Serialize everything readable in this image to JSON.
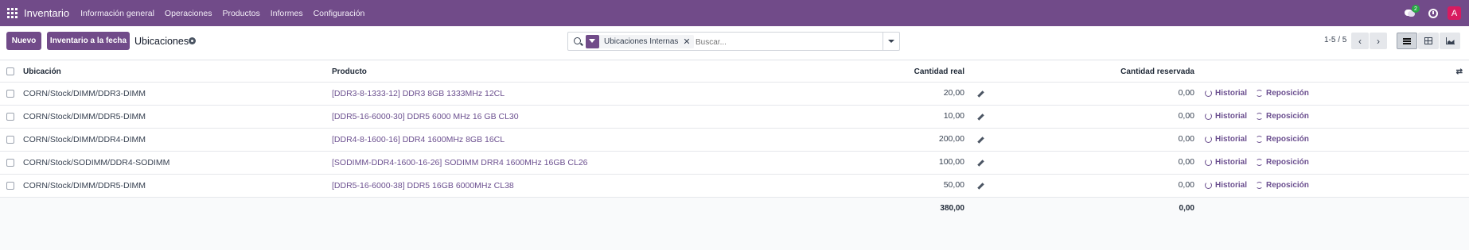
{
  "navbar": {
    "app_name": "Inventario",
    "menu": [
      "Información general",
      "Operaciones",
      "Productos",
      "Informes",
      "Configuración"
    ],
    "chat_count": "2",
    "avatar_letter": "A",
    "colors": {
      "brand": "#714b89",
      "avatar": "#d81b60",
      "badge": "#28a745"
    }
  },
  "control": {
    "new_label": "Nuevo",
    "inventory_label": "Inventario a la fecha",
    "breadcrumb": "Ubicaciones",
    "search": {
      "facet": "Ubicaciones Internas",
      "placeholder": "Buscar..."
    },
    "pager": "1-5 / 5"
  },
  "table": {
    "headers": {
      "location": "Ubicación",
      "product": "Producto",
      "qty": "Cantidad real",
      "reserved": "Cantidad reservada"
    },
    "rows": [
      {
        "location": "CORN/Stock/DIMM/DDR3-DIMM",
        "product": "[DDR3-8-1333-12] DDR3 8GB 1333MHz 12CL",
        "qty": "20,00",
        "reserved": "0,00"
      },
      {
        "location": "CORN/Stock/DIMM/DDR5-DIMM",
        "product": "[DDR5-16-6000-30] DDR5 6000 MHz 16 GB CL30",
        "qty": "10,00",
        "reserved": "0,00"
      },
      {
        "location": "CORN/Stock/DIMM/DDR4-DIMM",
        "product": "[DDR4-8-1600-16] DDR4 1600MHz 8GB 16CL",
        "qty": "200,00",
        "reserved": "0,00"
      },
      {
        "location": "CORN/Stock/SODIMM/DDR4-SODIMM",
        "product": "[SODIMM-DDR4-1600-16-26] SODIMM DRR4 1600MHz 16GB CL26",
        "qty": "100,00",
        "reserved": "0,00"
      },
      {
        "location": "CORN/Stock/DIMM/DDR5-DIMM",
        "product": "[DDR5-16-6000-38] DDR5 16GB 6000MHz CL38",
        "qty": "50,00",
        "reserved": "0,00"
      }
    ],
    "row_actions": {
      "history": "Historial",
      "replenish": "Reposición"
    },
    "totals": {
      "qty": "380,00",
      "reserved": "0,00"
    }
  }
}
